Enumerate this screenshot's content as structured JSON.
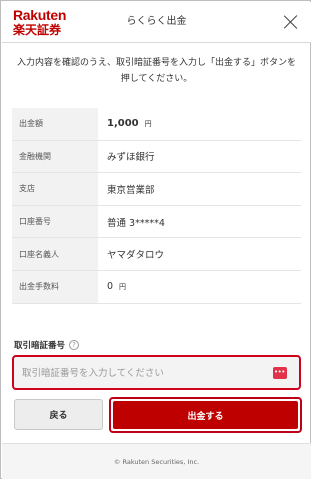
{
  "brand": {
    "logo_latin": "Rakuten",
    "logo_kanji": "楽天証券",
    "color": "#bf0000"
  },
  "header": {
    "title": "らくらく出金",
    "close_icon": "close-icon"
  },
  "instruction": "入力内容を確認のうえ、取引暗証番号を入力し「出金する」ボタンを押してください。",
  "details": [
    {
      "label": "出金額",
      "value": "1,000",
      "unit": "円"
    },
    {
      "label": "金融機関",
      "value": "みずほ銀行",
      "unit": ""
    },
    {
      "label": "支店",
      "value": "東京営業部",
      "unit": ""
    },
    {
      "label": "口座番号",
      "value": "普通 3*****4",
      "unit": ""
    },
    {
      "label": "口座名義人",
      "value": "ヤマダタロウ",
      "unit": ""
    },
    {
      "label": "出金手数料",
      "value": "0",
      "unit": "円"
    }
  ],
  "pin": {
    "label": "取引暗証番号",
    "help_icon": "?",
    "placeholder": "取引暗証番号を入力してください",
    "value": "",
    "keyboard_icon": "keyboard-icon"
  },
  "buttons": {
    "back": "戻る",
    "submit": "出金する"
  },
  "footer": "© Rakuten Securities, Inc."
}
